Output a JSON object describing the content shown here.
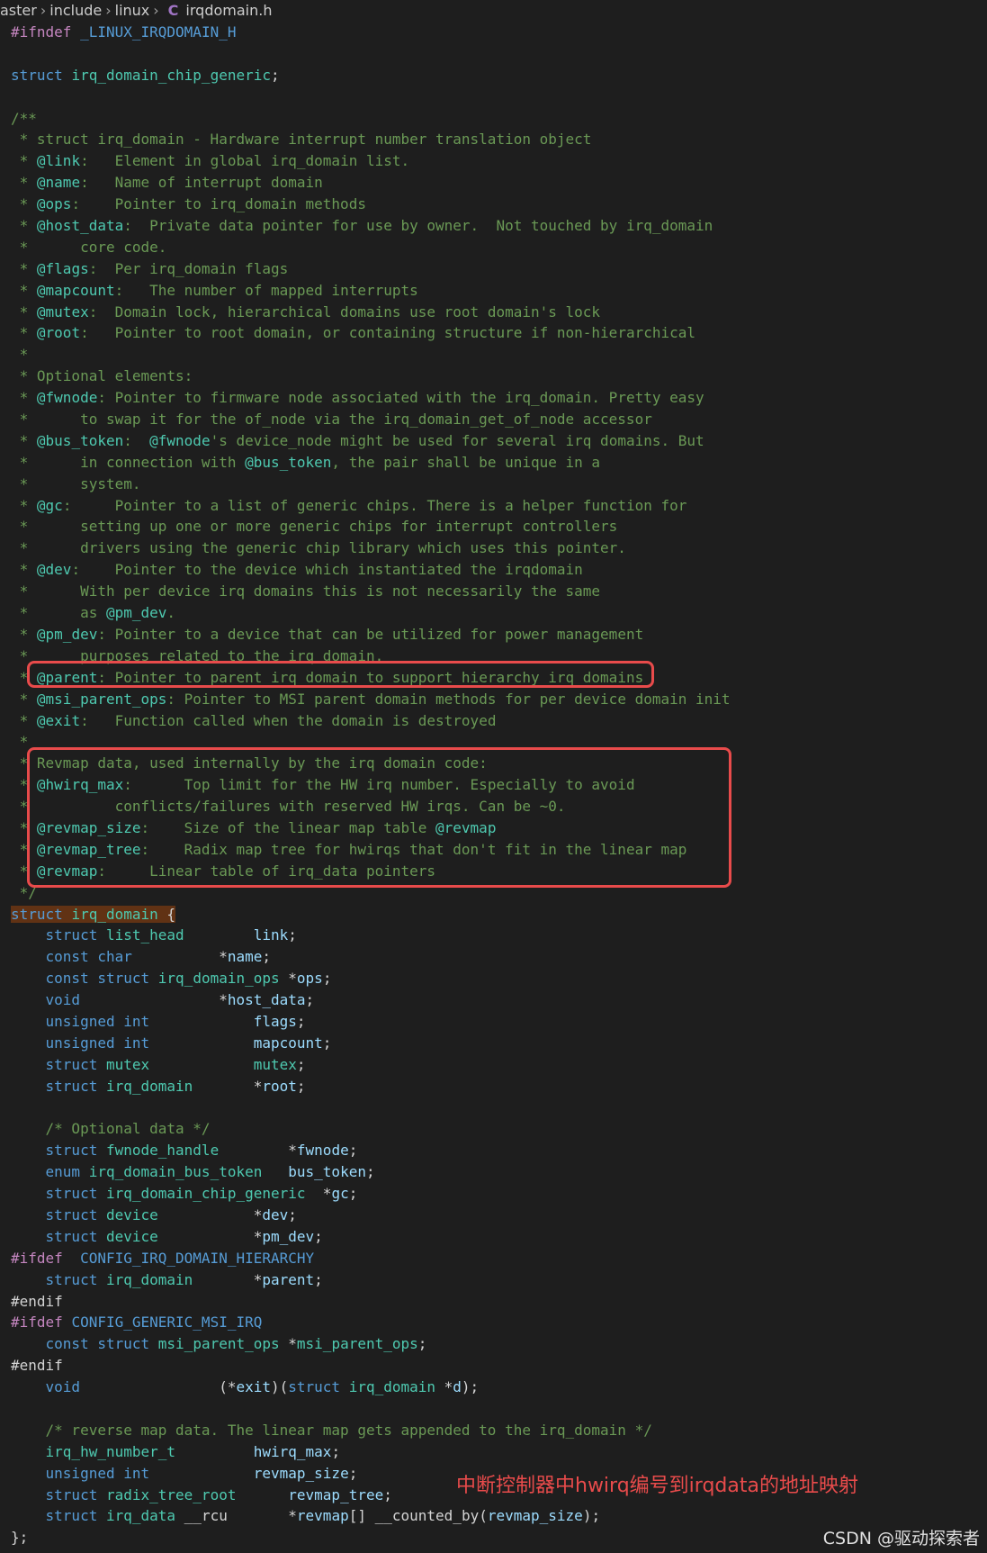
{
  "breadcrumb": {
    "items": [
      "aster",
      "include",
      "linux"
    ],
    "file_icon": "C",
    "file_name": "irqdomain.h"
  },
  "code_lines": [
    "#ifndef _LINUX_IRQDOMAIN_H",
    "",
    "struct irq_domain_chip_generic;",
    "",
    "/**",
    " * struct irq_domain - Hardware interrupt number translation object",
    " * @link:   Element in global irq_domain list.",
    " * @name:   Name of interrupt domain",
    " * @ops:    Pointer to irq_domain methods",
    " * @host_data:  Private data pointer for use by owner.  Not touched by irq_domain",
    " *      core code.",
    " * @flags:  Per irq_domain flags",
    " * @mapcount:   The number of mapped interrupts",
    " * @mutex:  Domain lock, hierarchical domains use root domain's lock",
    " * @root:   Pointer to root domain, or containing structure if non-hierarchical",
    " *",
    " * Optional elements:",
    " * @fwnode: Pointer to firmware node associated with the irq_domain. Pretty easy",
    " *      to swap it for the of_node via the irq_domain_get_of_node accessor",
    " * @bus_token:  @fwnode's device_node might be used for several irq domains. But",
    " *      in connection with @bus_token, the pair shall be unique in a",
    " *      system.",
    " * @gc:     Pointer to a list of generic chips. There is a helper function for",
    " *      setting up one or more generic chips for interrupt controllers",
    " *      drivers using the generic chip library which uses this pointer.",
    " * @dev:    Pointer to the device which instantiated the irqdomain",
    " *      With per device irq domains this is not necessarily the same",
    " *      as @pm_dev.",
    " * @pm_dev: Pointer to a device that can be utilized for power management",
    " *      purposes related to the irq domain.",
    " * @parent: Pointer to parent irq_domain to support hierarchy irq_domains",
    " * @msi_parent_ops: Pointer to MSI parent domain methods for per device domain init",
    " * @exit:   Function called when the domain is destroyed",
    " *",
    " * Revmap data, used internally by the irq domain code:",
    " * @hwirq_max:      Top limit for the HW irq number. Especially to avoid",
    " *          conflicts/failures with reserved HW irqs. Can be ~0.",
    " * @revmap_size:    Size of the linear map table @revmap",
    " * @revmap_tree:    Radix map tree for hwirqs that don't fit in the linear map",
    " * @revmap:     Linear table of irq_data pointers",
    " */",
    "struct irq_domain {",
    "    struct list_head        link;",
    "    const char          *name;",
    "    const struct irq_domain_ops *ops;",
    "    void                *host_data;",
    "    unsigned int            flags;",
    "    unsigned int            mapcount;",
    "    struct mutex            mutex;",
    "    struct irq_domain       *root;",
    "",
    "    /* Optional data */",
    "    struct fwnode_handle        *fwnode;",
    "    enum irq_domain_bus_token   bus_token;",
    "    struct irq_domain_chip_generic  *gc;",
    "    struct device           *dev;",
    "    struct device           *pm_dev;",
    "#ifdef  CONFIG_IRQ_DOMAIN_HIERARCHY",
    "    struct irq_domain       *parent;",
    "#endif",
    "#ifdef CONFIG_GENERIC_MSI_IRQ",
    "    const struct msi_parent_ops *msi_parent_ops;",
    "#endif",
    "    void                (*exit)(struct irq_domain *d);",
    "",
    "    /* reverse map data. The linear map gets appended to the irq_domain */",
    "    irq_hw_number_t         hwirq_max;",
    "    unsigned int            revmap_size;",
    "    struct radix_tree_root      revmap_tree;",
    "    struct irq_data __rcu       *revmap[] __counted_by(revmap_size);",
    "};"
  ],
  "annotation": "中断控制器中hwirq编号到irqdata的地址映射",
  "watermark": "CSDN @驱动探索者",
  "colors": {
    "background": "#1e1e1e",
    "comment": "#6a9955",
    "keyword": "#569cd6",
    "type": "#4ec9b0",
    "identifier": "#9cdcfe",
    "preprocessor": "#c586c0",
    "highlight_box": "#e84b4b"
  }
}
